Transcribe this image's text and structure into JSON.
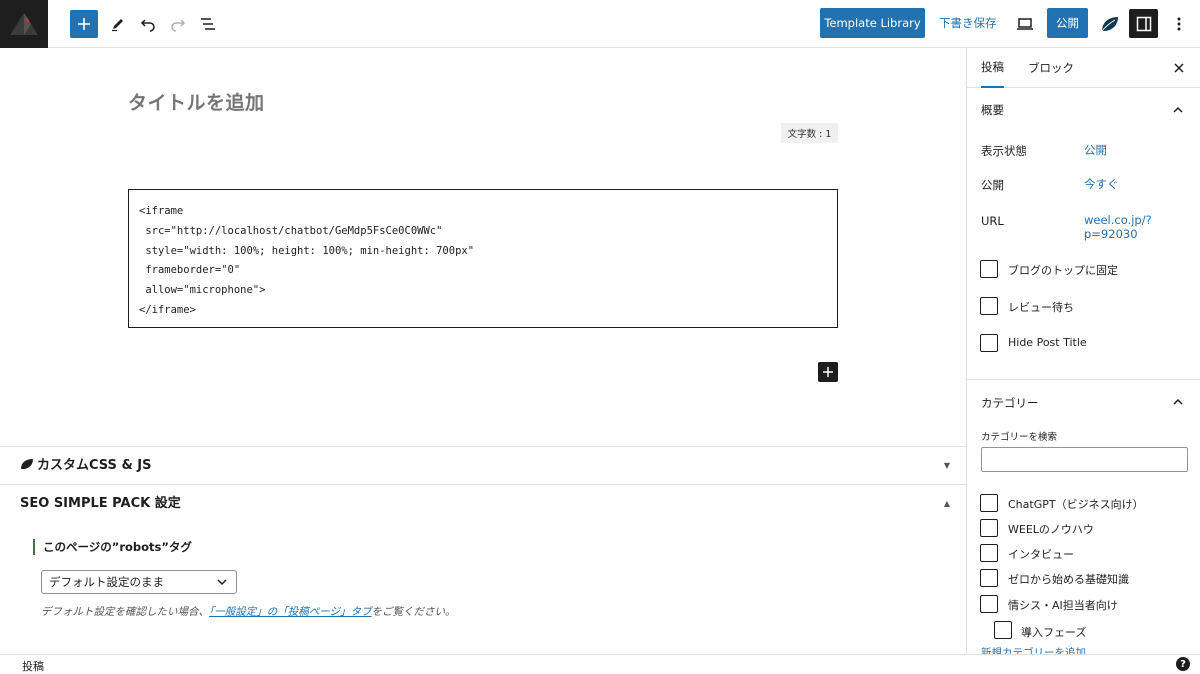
{
  "toolbar": {
    "template_library": "Template Library",
    "save_draft": "下書き保存",
    "publish": "公開"
  },
  "editor": {
    "title_placeholder": "タイトルを追加",
    "char_count": "文字数 : 1",
    "code_lines": [
      "<iframe",
      " src=\"http://localhost/chatbot/GeMdp5FsCe0C0WWc\"",
      " style=\"width: 100%; height: 100%; min-height: 700px\"",
      " frameborder=\"0\"",
      " allow=\"microphone\">",
      "</iframe>"
    ]
  },
  "metaboxes": {
    "custom_css_title": "カスタムCSS & JS",
    "seo_title": "SEO SIMPLE PACK 設定",
    "robots_label": "このページの”robots”タグ",
    "robots_select": "デフォルト設定のまま",
    "note_prefix": "デフォルト設定を確認したい場合、",
    "note_link": "「一般設定」の「投稿ページ」タブ",
    "note_suffix": "をご覧ください。"
  },
  "footer": {
    "breadcrumb": "投稿",
    "help": "?"
  },
  "sidebar": {
    "tabs": [
      "投稿",
      "ブロック"
    ],
    "summary": {
      "title": "概要",
      "visibility_label": "表示状態",
      "visibility_value": "公開",
      "publish_label": "公開",
      "publish_value": "今すぐ",
      "url_label": "URL",
      "url_value_line1": "weel.co.jp/?",
      "url_value_line2": "p=92030"
    },
    "options": [
      "ブログのトップに固定",
      "レビュー待ち",
      "Hide Post Title"
    ],
    "categories": {
      "title": "カテゴリー",
      "search_label": "カテゴリーを検索",
      "items": [
        "ChatGPT（ビジネス向け）",
        "WEELのノウハウ",
        "インタビュー",
        "ゼロから始める基礎知識",
        "情シス・AI担当者向け",
        "導入フェーズ"
      ],
      "add_new": "新規カテゴリーを追加"
    }
  },
  "colors": {
    "accent": "#2271b1",
    "dark": "#1e1e1e"
  }
}
